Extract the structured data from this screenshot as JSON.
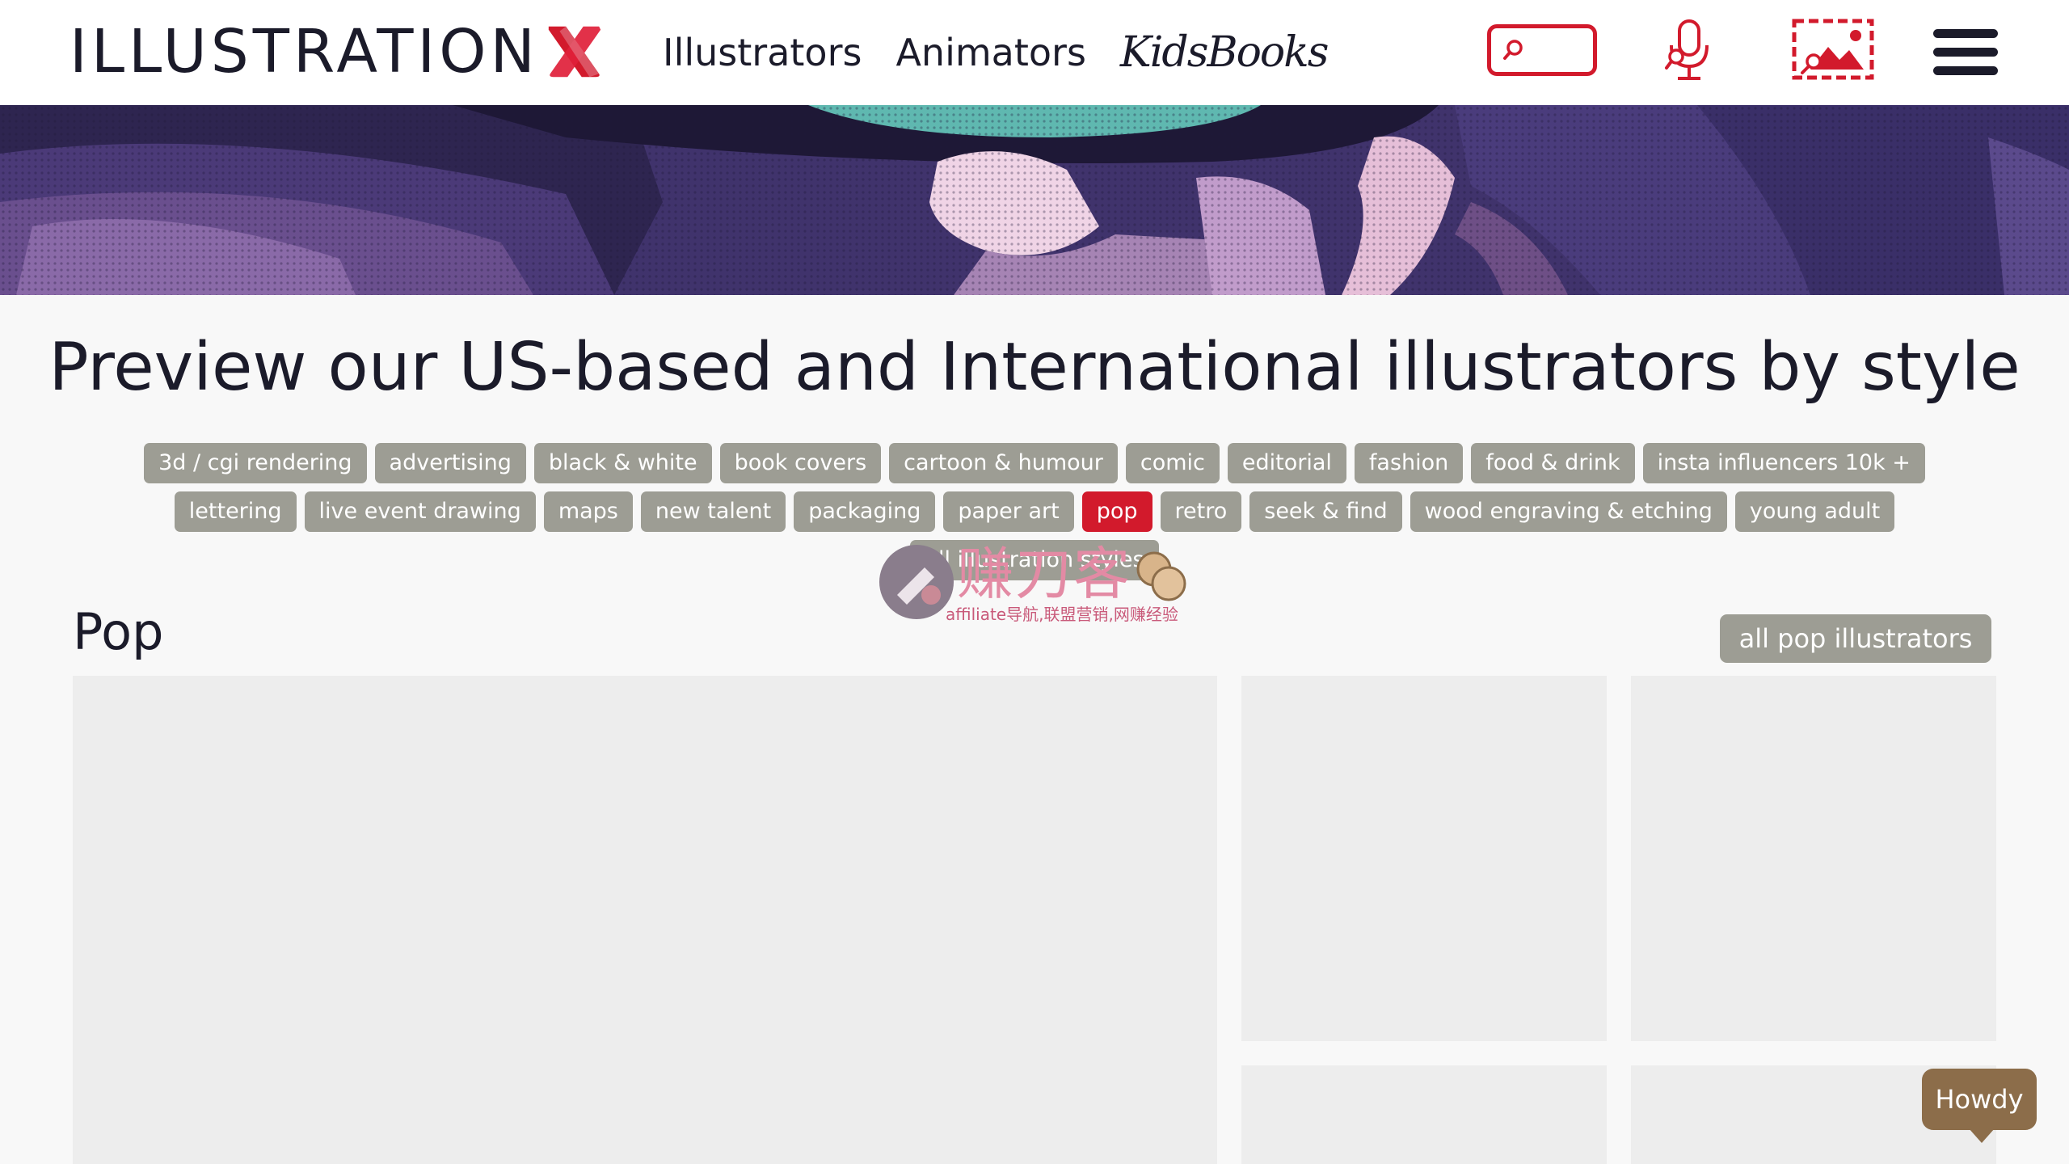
{
  "brand": {
    "logo_text": "ILLUSTRATION",
    "accent_color": "#d21a2c"
  },
  "nav": [
    {
      "label": "Illustrators"
    },
    {
      "label": "Animators"
    },
    {
      "label": "KidsBooks"
    }
  ],
  "search": {
    "placeholder": "",
    "icon": "search-icon"
  },
  "header_icons": [
    "search-icon",
    "microphone-icon",
    "image-search-icon",
    "menu-icon"
  ],
  "main": {
    "title": "Preview our US-based and International illustrators by style",
    "tags": [
      {
        "label": "3d / cgi rendering",
        "active": false
      },
      {
        "label": "advertising",
        "active": false
      },
      {
        "label": "black & white",
        "active": false
      },
      {
        "label": "book covers",
        "active": false
      },
      {
        "label": "cartoon & humour",
        "active": false
      },
      {
        "label": "comic",
        "active": false
      },
      {
        "label": "editorial",
        "active": false
      },
      {
        "label": "fashion",
        "active": false
      },
      {
        "label": "food & drink",
        "active": false
      },
      {
        "label": "insta influencers 10k +",
        "active": false
      },
      {
        "label": "lettering",
        "active": false
      },
      {
        "label": "live event drawing",
        "active": false
      },
      {
        "label": "maps",
        "active": false
      },
      {
        "label": "new talent",
        "active": false
      },
      {
        "label": "packaging",
        "active": false
      },
      {
        "label": "paper art",
        "active": false
      },
      {
        "label": "pop",
        "active": true
      },
      {
        "label": "retro",
        "active": false
      },
      {
        "label": "seek & find",
        "active": false
      },
      {
        "label": "wood engraving & etching",
        "active": false
      },
      {
        "label": "young adult",
        "active": false
      },
      {
        "label": "all illustration styles",
        "active": false
      }
    ],
    "section": {
      "title": "Pop",
      "all_button": "all pop illustrators"
    }
  },
  "watermark": {
    "title": "赚刀客",
    "subtitle": "affiliate导航,联盟营销,网赚经验"
  },
  "chat": {
    "label": "Howdy",
    "color": "#8c6d4a"
  }
}
